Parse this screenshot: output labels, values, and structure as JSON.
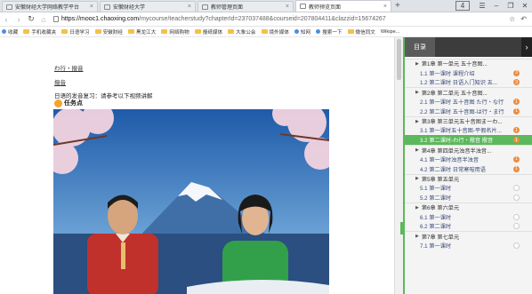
{
  "browser": {
    "tabs": [
      {
        "label": "安徽财经大学网络教学平台",
        "active": false
      },
      {
        "label": "安徽财经大学",
        "active": false
      },
      {
        "label": "教师管理页面",
        "active": false
      },
      {
        "label": "教师预览页面",
        "active": true
      }
    ],
    "new_tab": "+",
    "tab_count": "4",
    "url_host": "https://mooc1.chaoxing.com",
    "url_path": "/mycourse/teacherstudy?chapterId=237037488&courseid=207804411&clazzid=15674267",
    "bookmarks": [
      "收藏",
      "手机收藏夹",
      "日语学习",
      "安徽财经",
      "黑龙江大",
      "网络购物",
      "报纸媒体",
      "大象公会",
      "境外媒体",
      "知网",
      "搜索一下",
      "微信同文",
      "Wikipe..."
    ]
  },
  "page": {
    "breadcrumb": "わ行・撥音",
    "sublink": "撥音",
    "intro": "日语的发音复习：请参考以下视频讲解",
    "task_label": "任务点"
  },
  "panel": {
    "tab_label": "目录",
    "toggle_icon": "›",
    "toc": [
      {
        "type": "chapter",
        "text": "第1章 第一单元 五十音图..."
      },
      {
        "type": "lesson",
        "text": "1.1 第一课时 课程介绍",
        "badge": "3",
        "badge_color": "orange"
      },
      {
        "type": "lesson",
        "text": "1.2 第二课时 日语入门知识 五...",
        "badge": "3",
        "badge_color": "orange"
      },
      {
        "type": "chapter",
        "text": "第2章 第二单元 五十音图..."
      },
      {
        "type": "lesson",
        "text": "2.1 第一课时 五十音图 た行・な行",
        "badge": "1",
        "badge_color": "orange"
      },
      {
        "type": "lesson",
        "text": "2.2 第二课时 五十音图-は行・ま行",
        "badge": "1",
        "badge_color": "orange"
      },
      {
        "type": "chapter",
        "text": "第3章 第三单元五十音图まーわ..."
      },
      {
        "type": "lesson",
        "text": "3.1 第一课时五十音图-平假名片...",
        "badge": "1",
        "badge_color": "orange"
      },
      {
        "type": "lesson",
        "text": "3.2 第二课时-わ行・撥音 撥音",
        "badge": "1",
        "badge_color": "orange",
        "active": true
      },
      {
        "type": "chapter",
        "text": "第4章 第四单元浊音半浊音..."
      },
      {
        "type": "lesson",
        "text": "4.1 第一课时浊音半浊音",
        "badge": "1",
        "badge_color": "orange"
      },
      {
        "type": "lesson",
        "text": "4.2 第二课时 日常寒暄用语",
        "badge": "1",
        "badge_color": "orange"
      },
      {
        "type": "chapter",
        "text": "第5章 第五单元"
      },
      {
        "type": "lesson",
        "text": "5.1 第一课时",
        "badge": "",
        "badge_color": "white"
      },
      {
        "type": "lesson",
        "text": "5.2 第二课时",
        "badge": "",
        "badge_color": "white"
      },
      {
        "type": "chapter",
        "text": "第6章 第六单元"
      },
      {
        "type": "lesson",
        "text": "6.1 第一课时",
        "badge": "",
        "badge_color": "white"
      },
      {
        "type": "lesson",
        "text": "6.2 第二课时",
        "badge": "",
        "badge_color": "white"
      },
      {
        "type": "chapter",
        "text": "第7章 第七单元"
      },
      {
        "type": "lesson",
        "text": "7.1 第一课时",
        "badge": "",
        "badge_color": "white"
      }
    ]
  },
  "colors": {
    "accent": "#5cb85c",
    "badge": "#f08a3a",
    "panel_head": "#3c3c3c"
  }
}
